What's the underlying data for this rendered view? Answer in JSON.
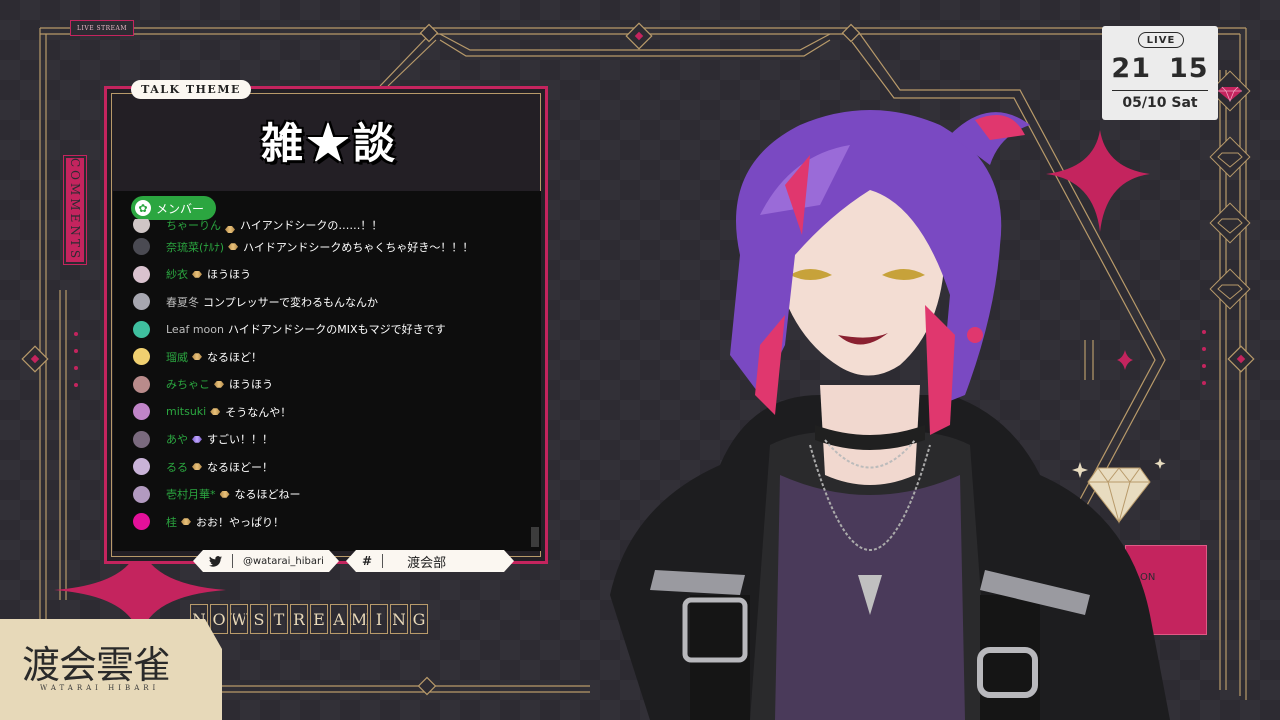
{
  "overlay": {
    "stream_tag": "LIVE STREAM",
    "talk_theme_label": "TALK THEME",
    "talk_title": "雑★談",
    "comments_tab": "COMMENTS",
    "now_streaming": [
      "N",
      "O",
      "W",
      "S",
      "T",
      "R",
      "E",
      "A",
      "M",
      "I",
      "N",
      "G"
    ],
    "twitter_handle": "@watarai_hibari",
    "hashtag": "渡会部",
    "name_jp": "渡会雲雀",
    "name_en": "WATARAI HIBARI",
    "sign_text": "ON"
  },
  "clock": {
    "live": "LIVE",
    "hour": "21",
    "minute": "15",
    "date": "05/10 Sat"
  },
  "chat": {
    "filter_label": "メンバー",
    "messages": [
      {
        "author": "ちゃーりん",
        "text": "ハイアンドシークの……！！",
        "member": true,
        "avatar": "#cfc6c6",
        "badge": "gold",
        "partial": true
      },
      {
        "author": "奈琉菜(ﾅﾙﾅ)",
        "text": "ハイドアンドシークめちゃくちゃ好き～！！！",
        "member": true,
        "avatar": "#4a4a52",
        "badge": "gold"
      },
      {
        "author": "紗衣",
        "text": "ほうほう",
        "member": true,
        "avatar": "#d9c2cf",
        "badge": "gold"
      },
      {
        "author": "春夏冬",
        "text": "コンプレッサーで変わるもんなんか",
        "member": false,
        "avatar": "#a7a7b0",
        "badge": ""
      },
      {
        "author": "Leaf moon",
        "text": "ハイドアンドシークのMIXもマジで好きです",
        "member": false,
        "avatar": "#3fbf9f",
        "badge": ""
      },
      {
        "author": "瑠威",
        "text": "なるほど！",
        "member": true,
        "avatar": "#f0d070",
        "badge": "gold"
      },
      {
        "author": "みちゃこ",
        "text": "ほうほう",
        "member": true,
        "avatar": "#b98b8b",
        "badge": "gold"
      },
      {
        "author": "mitsuki",
        "text": "そうなんや！",
        "member": true,
        "avatar": "#c084c8",
        "badge": "gold"
      },
      {
        "author": "あや",
        "text": "すごい！！！",
        "member": true,
        "avatar": "#7a6a7e",
        "badge": "purple"
      },
      {
        "author": "るる",
        "text": "なるほどー！",
        "member": true,
        "avatar": "#c9b3d8",
        "badge": "gold"
      },
      {
        "author": "壱村月華*",
        "text": "なるほどねー",
        "member": true,
        "avatar": "#b29ac0",
        "badge": "gold"
      },
      {
        "author": "桂",
        "text": "おお！やっぱり！",
        "member": true,
        "avatar": "#e4109a",
        "badge": "gold"
      }
    ]
  },
  "colors": {
    "accent": "#c4245e",
    "gold_line": "#b89a6a",
    "member_green": "#2ba640",
    "background": "#2d2b32"
  },
  "icons": [
    "twitter-bird-icon",
    "member-icon",
    "diamond-gem-icon",
    "four-point-star-icon"
  ]
}
